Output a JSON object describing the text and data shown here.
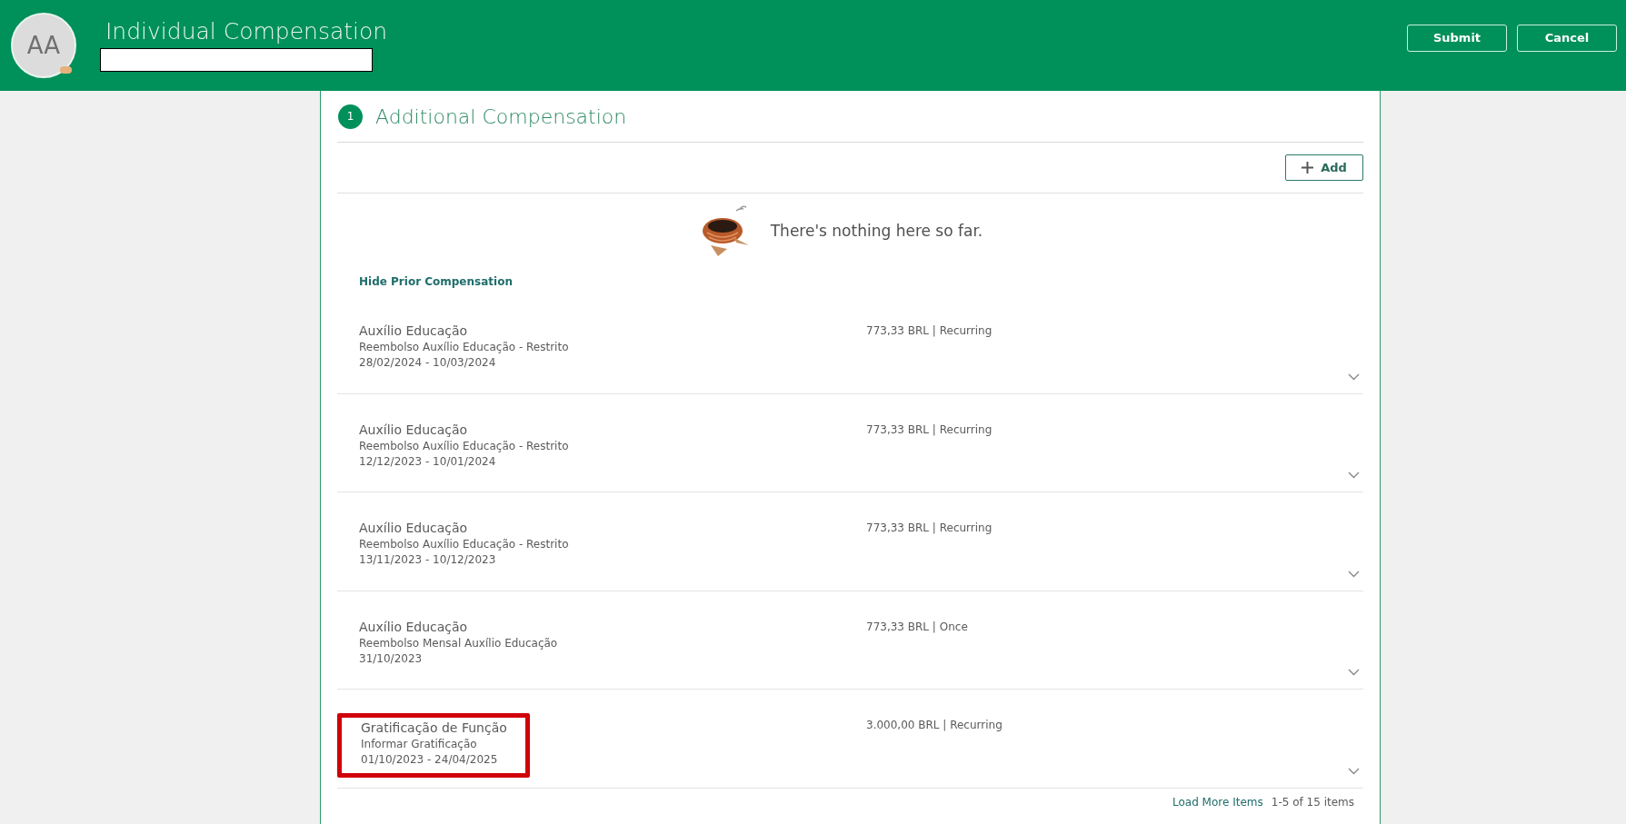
{
  "header": {
    "avatar_initials": "AA",
    "title": "Individual Compensation",
    "buttons": [
      {
        "label": "Submit"
      },
      {
        "label": "Cancel"
      }
    ]
  },
  "section": {
    "number": "1",
    "title": "Additional Compensation",
    "add_button": "Add",
    "empty_message": "There's nothing here so far.",
    "toggle_link": "Hide Prior Compensation",
    "items": [
      {
        "title": "Auxílio Educação",
        "subtitle": "Reembolso Auxílio Educação - Restrito",
        "dates": "28/02/2024 - 10/03/2024",
        "amount": "773,33 BRL | Recurring",
        "highlighted": false
      },
      {
        "title": "Auxílio Educação",
        "subtitle": "Reembolso Auxílio Educação - Restrito",
        "dates": "12/12/2023 - 10/01/2024",
        "amount": "773,33 BRL | Recurring",
        "highlighted": false
      },
      {
        "title": "Auxílio Educação",
        "subtitle": "Reembolso Auxílio Educação - Restrito",
        "dates": "13/11/2023 - 10/12/2023",
        "amount": "773,33 BRL | Recurring",
        "highlighted": false
      },
      {
        "title": "Auxílio Educação",
        "subtitle": "Reembolso Mensal Auxílio Educação",
        "dates": "31/10/2023",
        "amount": "773,33 BRL | Once",
        "highlighted": false
      },
      {
        "title": "Gratificação de Função",
        "subtitle": "Informar Gratificação",
        "dates": "01/10/2023 - 24/04/2025",
        "amount": "3.000,00 BRL | Recurring",
        "highlighted": true
      }
    ],
    "load_more": "Load More Items",
    "count": "1-5 of 15 items"
  }
}
